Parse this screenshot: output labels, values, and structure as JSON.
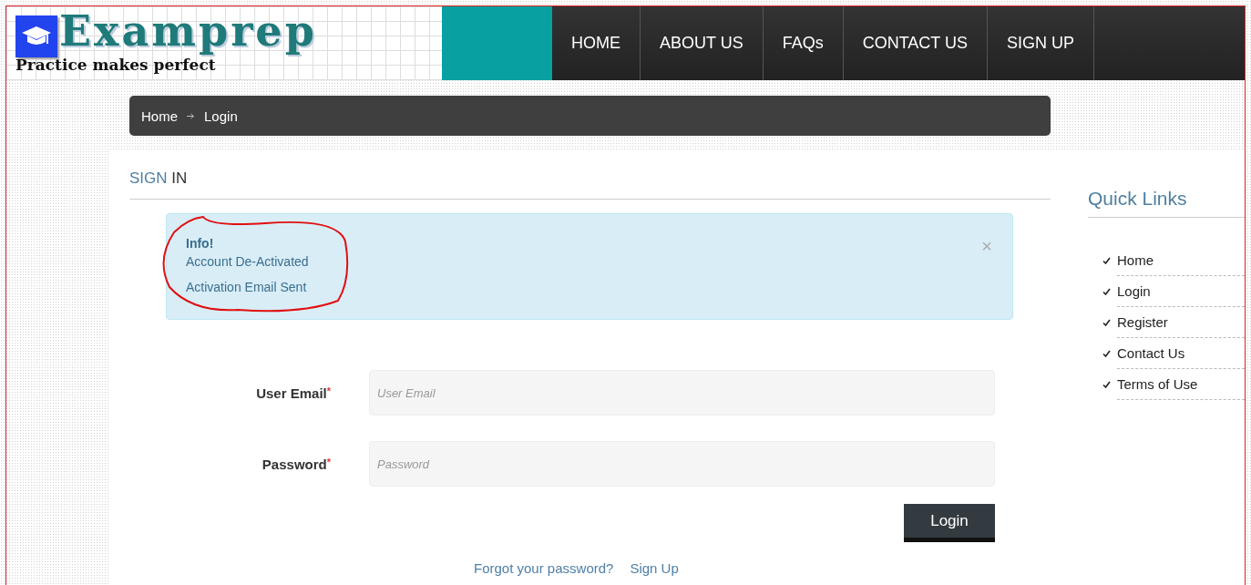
{
  "logo": {
    "name": "Examprep",
    "tagline": "Practice makes perfect"
  },
  "nav": [
    "HOME",
    "ABOUT US",
    "FAQs",
    "CONTACT US",
    "SIGN UP"
  ],
  "breadcrumb": [
    "Home",
    "Login"
  ],
  "section_title": [
    "SIGN",
    "IN"
  ],
  "alert": {
    "title": "Info!",
    "lines": [
      "Account De-Activated",
      "Activation Email Sent"
    ],
    "close": "×"
  },
  "form": {
    "fields": [
      {
        "label": "User Email",
        "required_mark": "*",
        "placeholder": "User Email"
      },
      {
        "label": "Password",
        "required_mark": "*",
        "placeholder": "Password"
      }
    ],
    "submit": "Login",
    "links": [
      "Forgot your password?",
      "Sign Up"
    ]
  },
  "quick_links": {
    "title": "Quick Links",
    "items": [
      "Home",
      "Login",
      "Register",
      "Contact Us",
      "Terms of Use"
    ]
  }
}
